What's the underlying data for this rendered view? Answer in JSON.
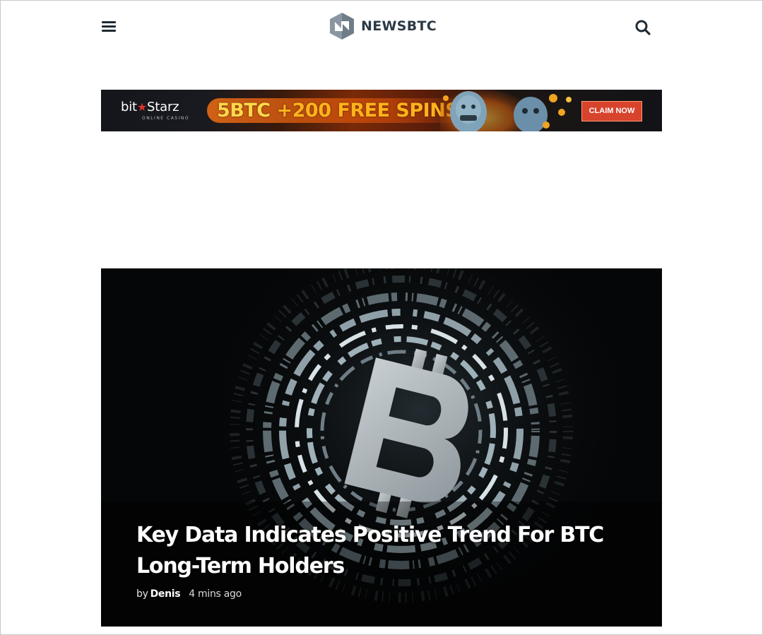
{
  "header": {
    "menu_icon": "hamburger-menu-icon",
    "logo_icon": "newsbtc-logo-mark",
    "logo_text": "NEWSBTC",
    "search_icon": "search-icon"
  },
  "banner": {
    "brand_left": "bit",
    "brand_star": "★",
    "brand_right": "Starz",
    "brand_sub": "ONLINE CASINO",
    "offer_num": "5BTC",
    "offer_rest": " +200 FREE SPINS",
    "cta_label": "CLAIM NOW"
  },
  "hero": {
    "title": "Key Data Indicates Positive Trend For BTC Long-Term Holders",
    "by_label": "by",
    "author": "Denis",
    "time": "4 mins ago"
  },
  "colors": {
    "logo_text": "#2c3a45",
    "offer_text": "#ffb21c",
    "cta_bg": "#d8432c",
    "hero_bg": "#050607"
  }
}
